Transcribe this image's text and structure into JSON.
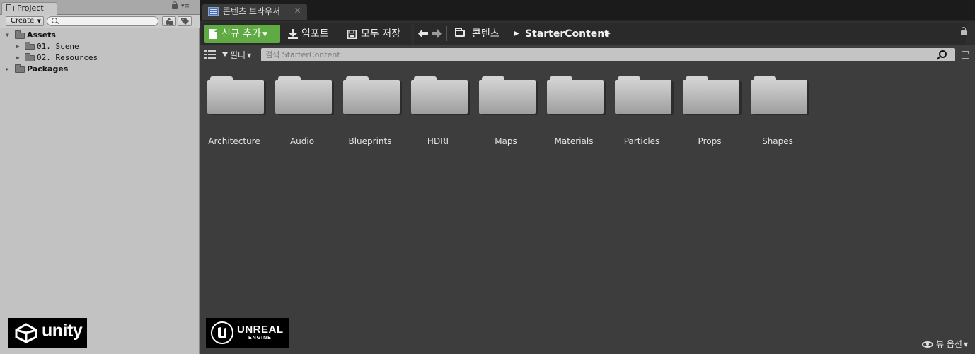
{
  "unity": {
    "tab_label": "Project",
    "menu_glyph": "▾≡",
    "create_label": "Create",
    "tree": [
      {
        "label": "Assets",
        "bold": true,
        "expanded": true
      },
      {
        "label": "01. Scene",
        "bold": false,
        "expanded": false
      },
      {
        "label": "02. Resources",
        "bold": false,
        "expanded": false
      },
      {
        "label": "Packages",
        "bold": true,
        "expanded": false
      }
    ],
    "logo_text": "unity"
  },
  "unreal": {
    "tab_label": "콘텐츠 브라우저",
    "tab_close": "×",
    "toolbar": {
      "new_label": "신규 추가",
      "import_label": "임포트",
      "save_all_label": "모두 저장"
    },
    "breadcrumb": [
      "콘텐츠",
      "StarterContent"
    ],
    "filter_label": "필터",
    "search_placeholder": "검색 StarterContent",
    "folders": [
      "Architecture",
      "Audio",
      "Blueprints",
      "HDRI",
      "Maps",
      "Materials",
      "Particles",
      "Props",
      "Shapes"
    ],
    "logo_line1": "UNREAL",
    "logo_line2": "ENGINE",
    "view_options_label": "뷰 옵션"
  }
}
